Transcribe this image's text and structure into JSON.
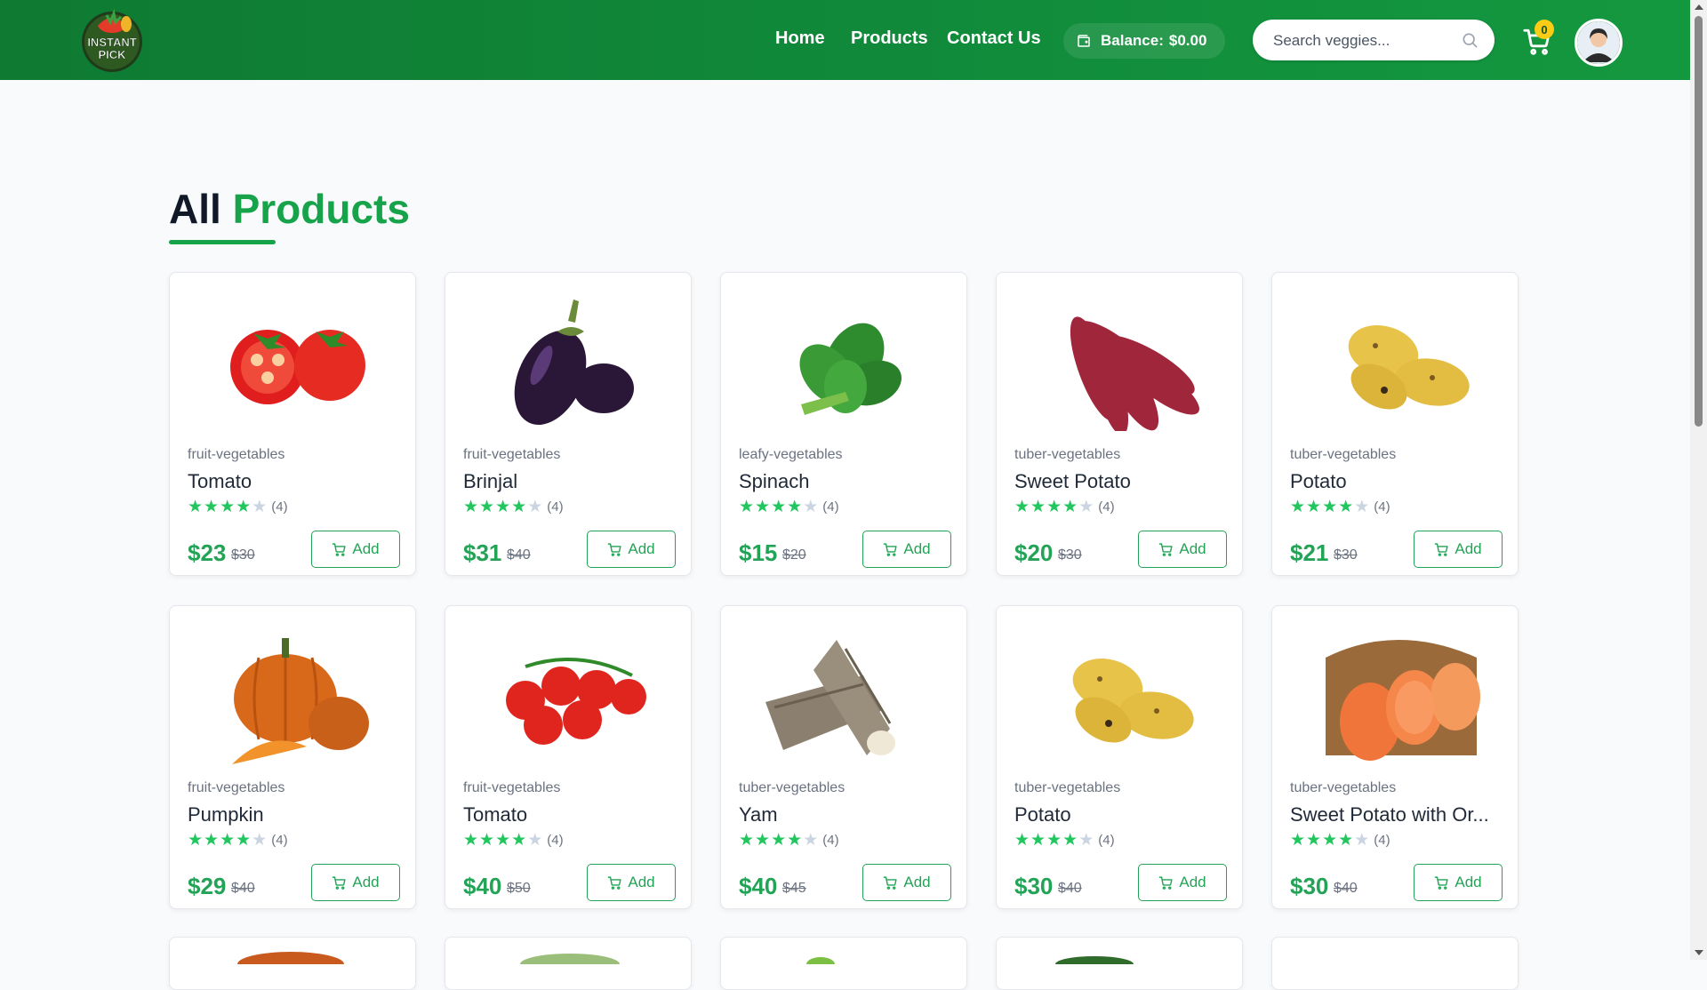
{
  "brand": {
    "logo_line1": "INSTANT",
    "logo_line2": "PICK"
  },
  "nav": {
    "home": "Home",
    "products": "Products",
    "contact": "Contact Us"
  },
  "balance": {
    "label": "Balance:",
    "amount": "$0.00"
  },
  "search": {
    "placeholder": "Search veggies..."
  },
  "cart": {
    "count": "0"
  },
  "heading": {
    "word1": "All",
    "word2": "Products"
  },
  "colors": {
    "brand_green": "#10893a",
    "accent_green": "#16a34a",
    "badge_yellow": "#facc15"
  },
  "products": [
    {
      "category": "fruit-vegetables",
      "name": "Tomato",
      "rating": 4,
      "reviews": "(4)",
      "price": "$23",
      "old_price": "$30",
      "add_label": "Add",
      "image": "tomato-image"
    },
    {
      "category": "fruit-vegetables",
      "name": "Brinjal",
      "rating": 4,
      "reviews": "(4)",
      "price": "$31",
      "old_price": "$40",
      "add_label": "Add",
      "image": "eggplant-image"
    },
    {
      "category": "leafy-vegetables",
      "name": "Spinach",
      "rating": 4,
      "reviews": "(4)",
      "price": "$15",
      "old_price": "$20",
      "add_label": "Add",
      "image": "spinach-image"
    },
    {
      "category": "tuber-vegetables",
      "name": "Sweet Potato",
      "rating": 4,
      "reviews": "(4)",
      "price": "$20",
      "old_price": "$30",
      "add_label": "Add",
      "image": "sweet-potato-image"
    },
    {
      "category": "tuber-vegetables",
      "name": "Potato",
      "rating": 4,
      "reviews": "(4)",
      "price": "$21",
      "old_price": "$30",
      "add_label": "Add",
      "image": "potato-image"
    },
    {
      "category": "fruit-vegetables",
      "name": "Pumpkin",
      "rating": 4,
      "reviews": "(4)",
      "price": "$29",
      "old_price": "$40",
      "add_label": "Add",
      "image": "pumpkin-image"
    },
    {
      "category": "fruit-vegetables",
      "name": "Tomato",
      "rating": 4,
      "reviews": "(4)",
      "price": "$40",
      "old_price": "$50",
      "add_label": "Add",
      "image": "cherry-tomato-image"
    },
    {
      "category": "tuber-vegetables",
      "name": "Yam",
      "rating": 4,
      "reviews": "(4)",
      "price": "$40",
      "old_price": "$45",
      "add_label": "Add",
      "image": "yam-image"
    },
    {
      "category": "tuber-vegetables",
      "name": "Potato",
      "rating": 4,
      "reviews": "(4)",
      "price": "$30",
      "old_price": "$40",
      "add_label": "Add",
      "image": "potato-image"
    },
    {
      "category": "tuber-vegetables",
      "name": "Sweet Potato with Or...",
      "rating": 4,
      "reviews": "(4)",
      "price": "$30",
      "old_price": "$40",
      "add_label": "Add",
      "image": "orange-sweet-potato-image"
    }
  ]
}
